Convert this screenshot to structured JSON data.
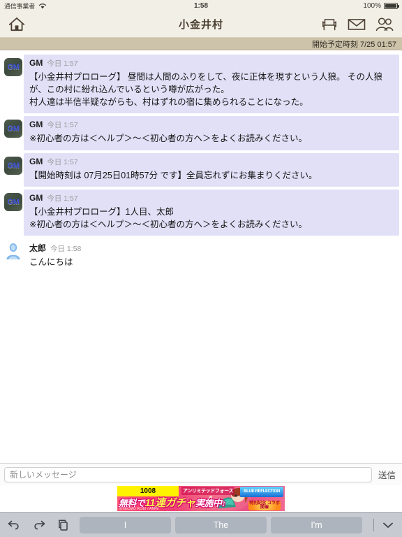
{
  "status_bar": {
    "carrier": "通信事業者",
    "wifi_icon": "wifi-icon",
    "time": "1:58",
    "battery_percent": "100%",
    "battery_icon": "battery-full-icon"
  },
  "nav_bar": {
    "home_icon": "home-icon",
    "title": "小金井村",
    "icons": [
      {
        "name": "seat-icon",
        "label": "座席"
      },
      {
        "name": "mail-icon",
        "label": "メール"
      },
      {
        "name": "members-icon",
        "label": "参加者"
      }
    ]
  },
  "sub_bar": {
    "label": "開始予定時刻 7/25 01:57"
  },
  "messages": [
    {
      "avatar": "gm-avatar",
      "avatar_text": "GM",
      "author": "GM",
      "time": "今日 1:57",
      "style": "gm",
      "text": "【小金井村プロローグ】 昼間は人間のふりをして、夜に正体を現すという人狼。 その人狼が、この村に紛れ込んでいるという噂が広がった。\n村人達は半信半疑ながらも、村はずれの宿に集められることになった。"
    },
    {
      "avatar": "gm-avatar",
      "avatar_text": "GM",
      "author": "GM",
      "time": "今日 1:57",
      "style": "gm",
      "text": "※初心者の方は＜ヘルプ＞〜＜初心者の方へ＞をよくお読みください。"
    },
    {
      "avatar": "gm-avatar",
      "avatar_text": "GM",
      "author": "GM",
      "time": "今日 1:57",
      "style": "gm",
      "text": "【開始時刻は 07月25日01時57分 です】全員忘れずにお集まりください。"
    },
    {
      "avatar": "gm-avatar",
      "avatar_text": "GM",
      "author": "GM",
      "time": "今日 1:57",
      "style": "gm",
      "text": "【小金井村プロローグ】1人目、太郎\n※初心者の方は＜ヘルプ＞〜＜初心者の方へ＞をよくお読みください。"
    },
    {
      "avatar": "user-avatar",
      "avatar_text": "",
      "author": "太郎",
      "time": "今日 1:58",
      "style": "plain",
      "text": "こんにちは"
    }
  ],
  "composer": {
    "placeholder": "新しいメッセージ",
    "value": "",
    "send_label": "送信"
  },
  "ad": {
    "number": "1008",
    "headline_prefix": "無料で",
    "headline_big": "11連ガチャ",
    "headline_suffix": "実施中♪",
    "top_caption": "アンリミテッドフォース",
    "copyright": "©TECMO KOEI / AMW",
    "logo_text": "BLUE REFLECTION",
    "badge_text": "特別記念 コラボ開催"
  },
  "keyboard_bar": {
    "tools": [
      {
        "name": "undo-icon",
        "label": "元に戻す"
      },
      {
        "name": "redo-icon",
        "label": "やり直す"
      },
      {
        "name": "paste-icon",
        "label": "ペースト"
      }
    ],
    "suggestions": [
      "I",
      "The",
      "I'm"
    ],
    "dismiss_icon": "chevron-down-icon"
  },
  "colors": {
    "nav_bg": "#f2efe6",
    "subbar_bg": "#cdc3ab",
    "bubble_gm": "#e2e0f7",
    "keyboard_bg": "#c7cbd1",
    "suggestion_bg": "#adb4bd",
    "gm_name_color": "#3b4fd8"
  }
}
